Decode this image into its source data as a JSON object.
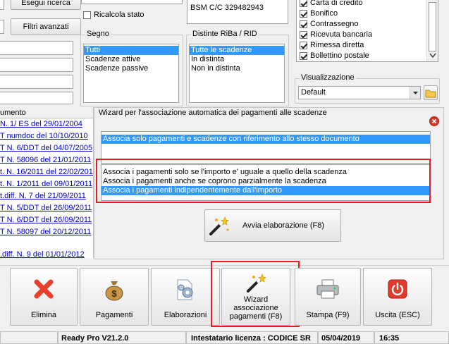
{
  "top_left": {
    "search_button": "Esegui ricerca",
    "advanced_filters_button": "Filtri avanzati"
  },
  "recalc": {
    "label": "Ricalcola stato",
    "checked": false
  },
  "bank_info": {
    "line": "BSM C/C 329482943"
  },
  "segno": {
    "title": "Segno",
    "items": [
      "Tutti",
      "Scadenze attive",
      "Scadenze passive"
    ],
    "selected": 0
  },
  "distinte": {
    "title": "Distinte RiBa / RID",
    "items": [
      "Tutte le scadenze",
      "In distinta",
      "Non in distinta"
    ],
    "selected": 0
  },
  "payment_types": {
    "items": [
      {
        "label": "Carta di credito",
        "checked": true
      },
      {
        "label": "Bonifico",
        "checked": true
      },
      {
        "label": "Contrassegno",
        "checked": true
      },
      {
        "label": "Ricevuta bancaria",
        "checked": true
      },
      {
        "label": "Rimessa diretta",
        "checked": true
      },
      {
        "label": "Bollettino postale",
        "checked": true
      }
    ]
  },
  "visualizzazione": {
    "title": "Visualizzazione",
    "value": "Default"
  },
  "left_list": {
    "header": "umento",
    "rows": [
      "N. 1/ ES del 29/01/2004",
      "T numdoc del 10/10/2010",
      "T N. 6/DDT del 04/07/2005",
      "T N. 58096 del 21/01/2011",
      "t. N. 16/2011 del 22/02/2011",
      "t. N. 1/2011 del 09/01/2011",
      "t.diff. N. 7 del 21/09/2011",
      "T N. 5/DDT del 26/09/2011",
      "T N. 6/DDT del 26/09/2011",
      "T N. 58097 del 20/12/2011",
      "",
      ".diff. N. 9 del 01/01/2012"
    ]
  },
  "wizard": {
    "title": "Wizard per l'associazione automatica dei pagamenti alle scadenze",
    "option_top": "Associa solo pagamenti e scadenze con riferimento allo stesso documento",
    "options": [
      "Associa i pagamenti solo se l'importo e' uguale a quello della scadenza",
      "Associa i pagamenti anche se coprono parzialmente la scadenza",
      "Associa i pagamenti indipendentemente dall'importo"
    ],
    "selected_option": 2,
    "run_button": "Avvia elaborazione (F8)"
  },
  "toolbar": {
    "buttons": [
      {
        "label": "Elimina",
        "icon": "delete-x-icon"
      },
      {
        "label": "Pagamenti",
        "icon": "money-bag-icon"
      },
      {
        "label": "Elaborazioni",
        "icon": "gears-doc-icon"
      },
      {
        "label": "Wizard associazione pagamenti (F8)",
        "icon": "magic-wand-icon"
      },
      {
        "label": "Stampa (F9)",
        "icon": "printer-icon"
      },
      {
        "label": "Uscita (ESC)",
        "icon": "power-icon"
      }
    ]
  },
  "status_bar": {
    "app": "Ready Pro V21.2.0",
    "license": "Intestatario licenza : CODICE SR",
    "date": "05/04/2019",
    "time": "16:35"
  },
  "colors": {
    "selection": "#3399ff",
    "highlight_box": "#e02020",
    "link": "#0000cc"
  }
}
